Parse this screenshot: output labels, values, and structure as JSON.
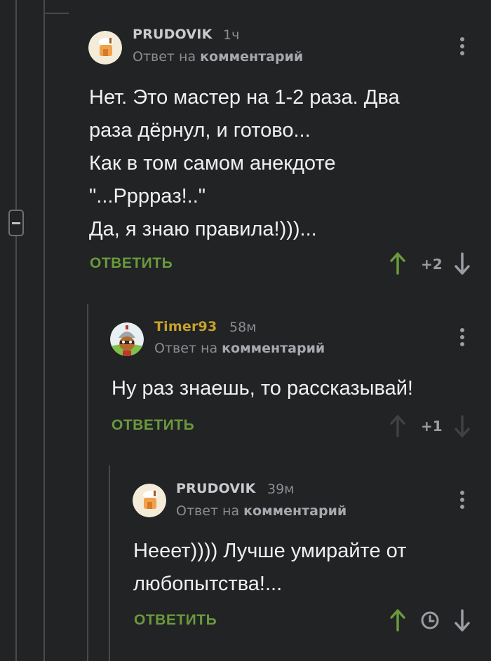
{
  "comments": [
    {
      "author": "PRUDOVIK",
      "time": "1ч",
      "reply_prefix": "Ответ на ",
      "reply_target": "комментарий",
      "text": "Нет. Это мастер на 1-2 раза. Два\nраза дёрнул, и готово...\nКак в том самом анекдоте\n\"...Ррррaз!..\"\nДа, я знаю правила!)))...",
      "reply_label": "ОТВЕТИТЬ",
      "score": "+2",
      "author_color": "#c9cbce"
    },
    {
      "author": "Timer93",
      "time": "58м",
      "reply_prefix": "Ответ на ",
      "reply_target": "комментарий",
      "text": "Ну раз знаешь, то рассказывай!",
      "reply_label": "ОТВЕТИТЬ",
      "score": "+1",
      "author_color": "#c7a12a"
    },
    {
      "author": "PRUDOVIK",
      "time": "39м",
      "reply_prefix": "Ответ на ",
      "reply_target": "комментарий",
      "text": "Нееет)))) Лучше умирайте от\nлюбопытства!...",
      "reply_label": "ОТВЕТИТЬ",
      "author_color": "#c9cbce"
    }
  ],
  "colors": {
    "background": "#212325",
    "reply_green": "#6a9a3c",
    "upvote_green": "#6a9a3c",
    "muted": "#8a8d91"
  }
}
